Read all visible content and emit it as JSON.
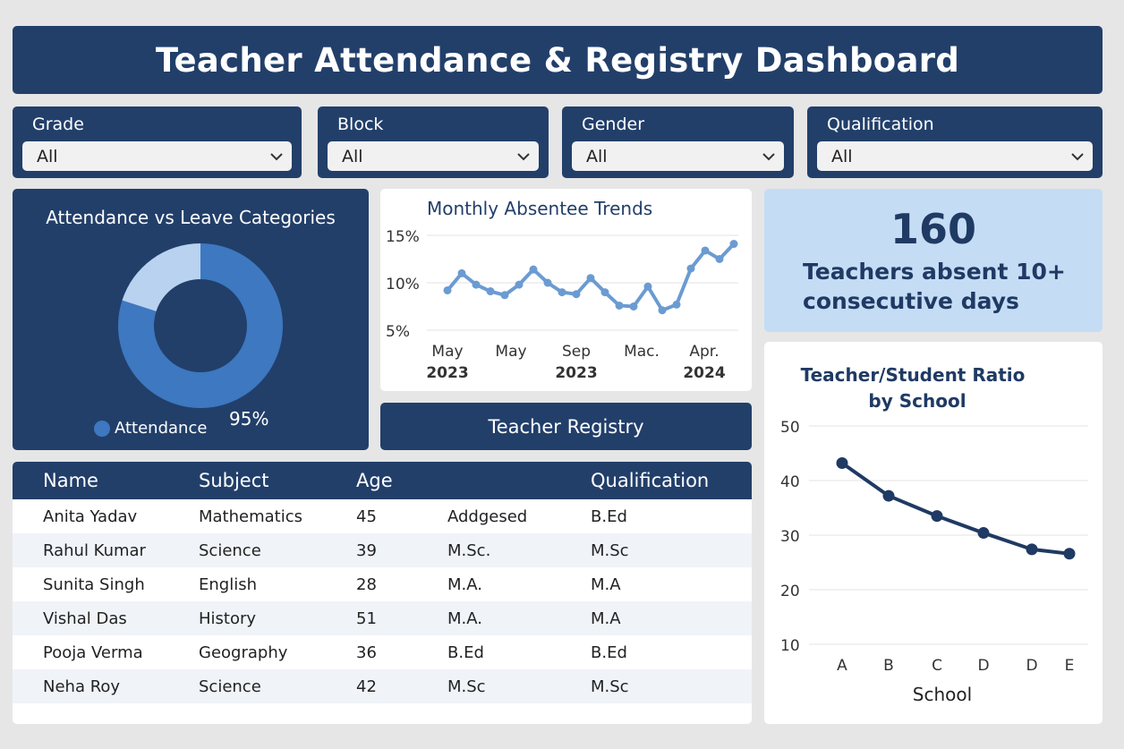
{
  "title": "Teacher Attendance & Registry Dashboard",
  "filters": [
    {
      "label": "Grade",
      "value": "All"
    },
    {
      "label": "Block",
      "value": "All"
    },
    {
      "label": "Gender",
      "value": "All"
    },
    {
      "label": "Qualification",
      "value": "All"
    }
  ],
  "donut": {
    "title": "Attendance vs Leave Categories",
    "legend_label": "Attendance",
    "percent_label": "95%",
    "segments": [
      {
        "name": "Attendance",
        "fraction": 0.8,
        "color": "#3d78c0"
      },
      {
        "name": "",
        "fraction": 0.2,
        "color": "#b8d2f0"
      }
    ]
  },
  "trend": {
    "title": "Monthly Absentee Trends",
    "y_ticks": [
      "15%",
      "10%",
      "5%"
    ],
    "x_labels": [
      {
        "line1": "May",
        "line2": "2023"
      },
      {
        "line1": "May",
        "line2": ""
      },
      {
        "line1": "Sep",
        "line2": "2023"
      },
      {
        "line1": "Mac.",
        "line2": ""
      },
      {
        "line1": "Apr.",
        "line2": "2024"
      }
    ]
  },
  "kpi": {
    "value": "160",
    "label": "Teachers absent 10+ consecutive days"
  },
  "registry_button": "Teacher Registry",
  "table": {
    "headers": [
      "Name",
      "Subject",
      "Age",
      "",
      "Qualification"
    ],
    "rows": [
      [
        "Anita Yadav",
        "Mathematics",
        "45",
        "Addgesed",
        "B.Ed"
      ],
      [
        "Rahul Kumar",
        "Science",
        "39",
        "M.Sc.",
        "M.Sc"
      ],
      [
        "Sunita Singh",
        "English",
        "28",
        "M.A.",
        "M.A"
      ],
      [
        "Vishal Das",
        "History",
        "51",
        "M.A.",
        "M.A"
      ],
      [
        "Pooja Verma",
        "Geography",
        "36",
        "B.Ed",
        "B.Ed"
      ],
      [
        "Neha Roy",
        "Science",
        "42",
        "M.Sc",
        "M.Sc"
      ]
    ]
  },
  "chart_data": [
    {
      "type": "line",
      "title": "Monthly Absentee Trends",
      "ylim": [
        5,
        15
      ],
      "y_ticks": [
        15,
        10,
        5
      ],
      "unit": "%",
      "x_tick_labels": [
        "May 2023",
        "May",
        "Sep 2023",
        "Mac.",
        "Apr. 2024"
      ],
      "series": [
        {
          "values": [
            9.2,
            11.0,
            9.8,
            9.1,
            8.7,
            9.8,
            11.4,
            10.0,
            9.0,
            8.8,
            10.5,
            9.0,
            7.6,
            7.5,
            9.6,
            7.1,
            7.7,
            11.5,
            13.4,
            12.5,
            14.1
          ],
          "color": "#6b9bd2"
        }
      ]
    },
    {
      "type": "line",
      "title": "Teacher/Student Ratio by School",
      "xlabel": "School",
      "ylabel": "",
      "categories": [
        "A",
        "B",
        "C",
        "D",
        "D",
        "E"
      ],
      "ylim": [
        10,
        50
      ],
      "y_ticks": [
        50,
        40,
        30,
        20,
        10
      ],
      "series": [
        {
          "values": [
            43.2,
            37.2,
            33.5,
            30.4,
            27.4,
            26.6
          ],
          "color": "#1f3a63"
        }
      ]
    },
    {
      "type": "pie",
      "title": "Attendance vs Leave Categories",
      "slices": [
        {
          "label": "Attendance",
          "value": 80
        },
        {
          "label": "",
          "value": 20
        }
      ]
    }
  ]
}
